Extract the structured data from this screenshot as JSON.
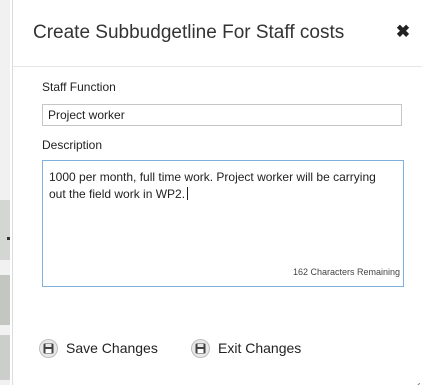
{
  "dialog": {
    "title": "Create Subbudgetline For Staff costs",
    "close_icon": "close-icon"
  },
  "form": {
    "staff_function": {
      "label": "Staff Function",
      "value": "Project worker"
    },
    "description": {
      "label": "Description",
      "value": "1000 per month, full time work. Project worker will be carrying out the field work in WP2.",
      "remaining": "162 Characters Remaining"
    }
  },
  "actions": {
    "save_label": "Save Changes",
    "save_icon": "floppy-disk-icon",
    "exit_label": "Exit Changes",
    "exit_icon": "floppy-disk-icon"
  },
  "colors": {
    "focus_border": "#7fb0df",
    "input_border": "#c6c6c6",
    "text": "#222222"
  }
}
